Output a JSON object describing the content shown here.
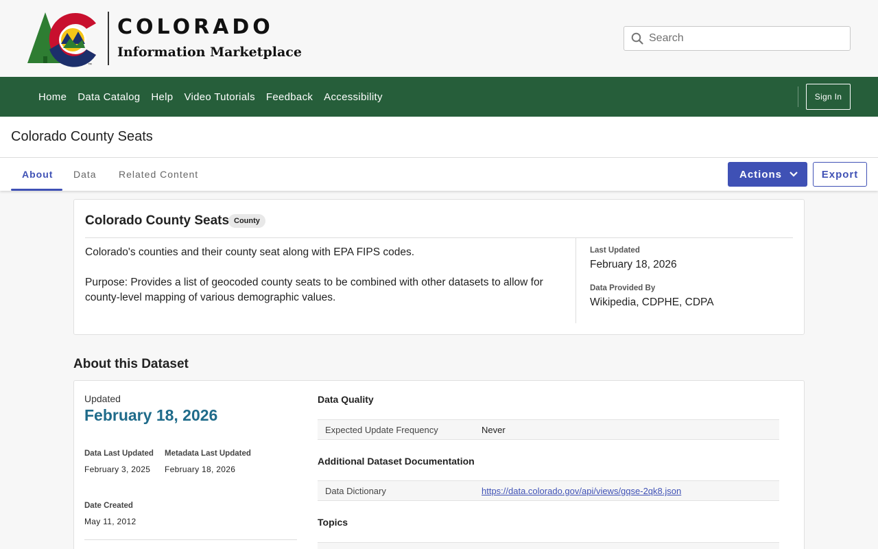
{
  "header": {
    "brand_title": "COLORADO",
    "brand_subtitle": "Information Marketplace",
    "logo_tm": "™",
    "search_placeholder": "Search"
  },
  "nav": {
    "links": [
      "Home",
      "Data Catalog",
      "Help",
      "Video Tutorials",
      "Feedback",
      "Accessibility"
    ],
    "sign_in": "Sign In"
  },
  "page": {
    "title": "Colorado County Seats"
  },
  "tabs": {
    "items": [
      "About",
      "Data",
      "Related Content"
    ],
    "active": "About",
    "actions_label": "Actions",
    "export_label": "Export"
  },
  "summary": {
    "title": "Colorado County Seats",
    "tag": "County",
    "description": "Colorado's counties and their county seat along with EPA FIPS codes.\n\nPurpose: Provides a list of geocoded county seats to be combined with other datasets to allow for county-level mapping of various demographic values.",
    "last_updated_label": "Last Updated",
    "last_updated_value": "February 18, 2026",
    "provided_by_label": "Data Provided By",
    "provided_by_value": "Wikipedia, CDPHE, CDPA"
  },
  "about": {
    "heading": "About this Dataset",
    "updated_label": "Updated",
    "updated_value": "February 18, 2026",
    "data_last_updated_label": "Data Last Updated",
    "data_last_updated_value": "February 3, 2025",
    "metadata_last_updated_label": "Metadata Last Updated",
    "metadata_last_updated_value": "February 18, 2026",
    "date_created_label": "Date Created",
    "date_created_value": "May 11, 2012",
    "data_quality_title": "Data Quality",
    "update_frequency_key": "Expected Update Frequency",
    "update_frequency_value": "Never",
    "additional_docs_title": "Additional Dataset Documentation",
    "data_dictionary_key": "Data Dictionary",
    "data_dictionary_value": "https://data.colorado.gov/api/views/gqse-2qk8.json",
    "topics_title": "Topics"
  },
  "colors": {
    "nav_green": "#265e3a",
    "accent_blue": "#3f51b5",
    "updated_teal": "#1f6b8a",
    "logo_red": "#c8102e",
    "logo_navy": "#1c2f6b",
    "logo_gold": "#f5c518",
    "logo_tree_green": "#2e7d32"
  }
}
